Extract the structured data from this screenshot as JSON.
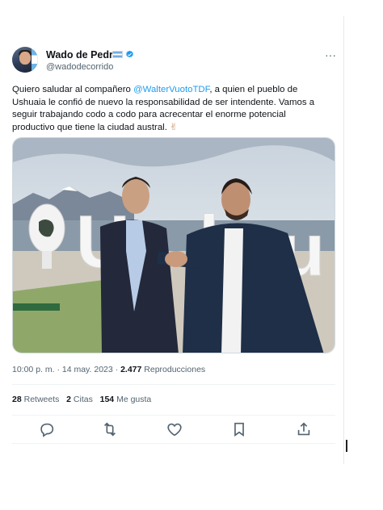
{
  "author": {
    "name": "Wado de Pedro",
    "handle": "@wadodecorrido",
    "flag_icon": "argentina-flag-icon",
    "verified_icon": "verified-badge-icon"
  },
  "tweet": {
    "text_before": "Quiero saludar al compañero ",
    "mention": "@WalterVuotoTDF",
    "text_after": ",  a quien el pueblo de Ushuaia le confió de nuevo la responsabilidad de ser intendente. Vamos a seguir trabajando codo a codo para acrecentar el enorme potencial productivo que tiene la ciudad austral.",
    "emoji": "✌",
    "mention_color": "#1d9bf0"
  },
  "photo": {
    "sign_letters": [
      "U",
      "s",
      "h",
      "u"
    ]
  },
  "meta": {
    "time": "10:00 p. m.",
    "separator1": " · ",
    "date": "14 may. 2023",
    "separator2": " · ",
    "views_count": "2.477",
    "views_label": " Reproducciones"
  },
  "stats": {
    "retweets_count": "28",
    "retweets_label": "Retweets",
    "quotes_count": "2",
    "quotes_label": "Citas",
    "likes_count": "154",
    "likes_label": "Me gusta"
  },
  "actions": [
    "reply-icon",
    "retweet-icon",
    "like-icon",
    "bookmark-icon",
    "share-icon"
  ],
  "more_label": "···"
}
